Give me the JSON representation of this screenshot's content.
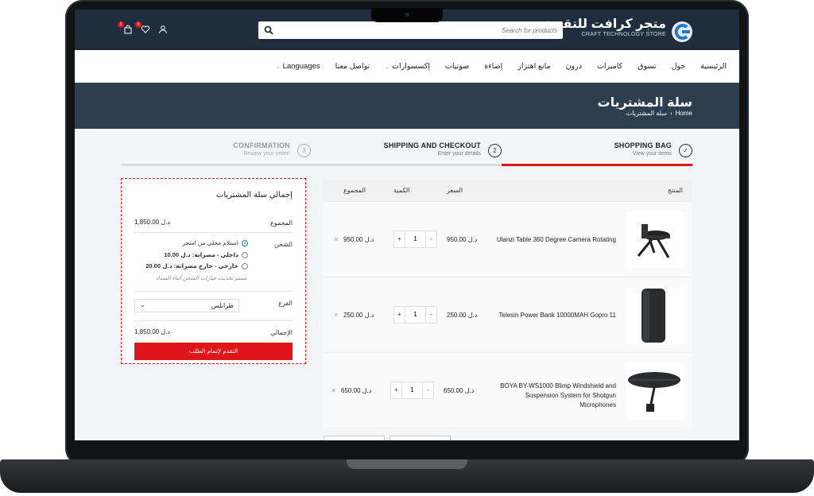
{
  "header": {
    "logo_ar": "متجر كرافت للتقنية",
    "logo_en": "CRAFT TECHNOLOGY STORE",
    "search_placeholder": "Search for products",
    "cart_count": "3",
    "wishlist_count": "0"
  },
  "nav": {
    "items": [
      {
        "label": "الرئيسية",
        "has_caret": false
      },
      {
        "label": "جول",
        "has_caret": false
      },
      {
        "label": "تسوق",
        "has_caret": false
      },
      {
        "label": "كاميرات",
        "has_caret": false
      },
      {
        "label": "درون",
        "has_caret": false
      },
      {
        "label": "مانع اهتزاز",
        "has_caret": false
      },
      {
        "label": "إضاءة",
        "has_caret": false
      },
      {
        "label": "صوتيات",
        "has_caret": false
      },
      {
        "label": "إكسسوارات",
        "has_caret": true
      },
      {
        "label": "تواصل معنا",
        "has_caret": false
      },
      {
        "label": "Languages",
        "has_caret": true
      }
    ]
  },
  "page": {
    "title": "سلة المشتريات",
    "breadcrumb_home": "Home",
    "breadcrumb_sep": "›",
    "breadcrumb_current": "سلة المشتريات"
  },
  "steps": [
    {
      "title": "SHOPPING BAG",
      "sub": "View your items",
      "marker": "✓",
      "active": true
    },
    {
      "title": "SHIPPING AND CHECKOUT",
      "sub": "Enter your details",
      "marker": "2",
      "active": false
    },
    {
      "title": "CONFIRMATION",
      "sub": "Review your order!",
      "marker": "3",
      "active": false
    }
  ],
  "cart": {
    "col_product": "المنتج",
    "col_price": "السعر",
    "col_qty": "الكمية",
    "col_total": "المجموع",
    "items": [
      {
        "name": "Ulanzi Table 360 Degree Camera Rotating",
        "price": "950.00 د.ل",
        "qty": "1",
        "total": "950.00 د.ل"
      },
      {
        "name": "Telesin Power Bank 10000MAH Gopro 11",
        "price": "250.00 د.ل",
        "qty": "1",
        "total": "250.00 د.ل"
      },
      {
        "name": "BOYA BY-WS1000 Blimp Windshield and Suspension System for Shotgun Microphones",
        "price": "650.00 د.ل",
        "qty": "1",
        "total": "650.00 د.ل"
      }
    ],
    "plus": "+",
    "minus": "-",
    "remove": "×"
  },
  "summary": {
    "title": "إجمالي سلة المشتريات",
    "subtotal_label": "المجموع",
    "subtotal_value": "1,850.00 د.ل",
    "shipping_label": "الشحن",
    "shipping_options": [
      {
        "text": "استلام محلي من امتجر",
        "selected": true
      },
      {
        "text": "داخلي - مصراتة: د.ل 10.00",
        "selected": false
      },
      {
        "text": "خارجي - خارج مصراتة: د.ل 20.00",
        "selected": false
      }
    ],
    "shipping_note": "سيتم تحديث خيارات الشحن أثناء السداد.",
    "branch_label": "الفرع",
    "branch_value": "طرابلس",
    "total_label": "الإجمالي",
    "total_value": "1,850.00 د.ل",
    "checkout_label": "التقدم لإتمام الطلب"
  },
  "colors": {
    "header_bg": "#1f2d3d",
    "page_head_bg": "#2d3e4f",
    "accent": "#e0141b"
  }
}
